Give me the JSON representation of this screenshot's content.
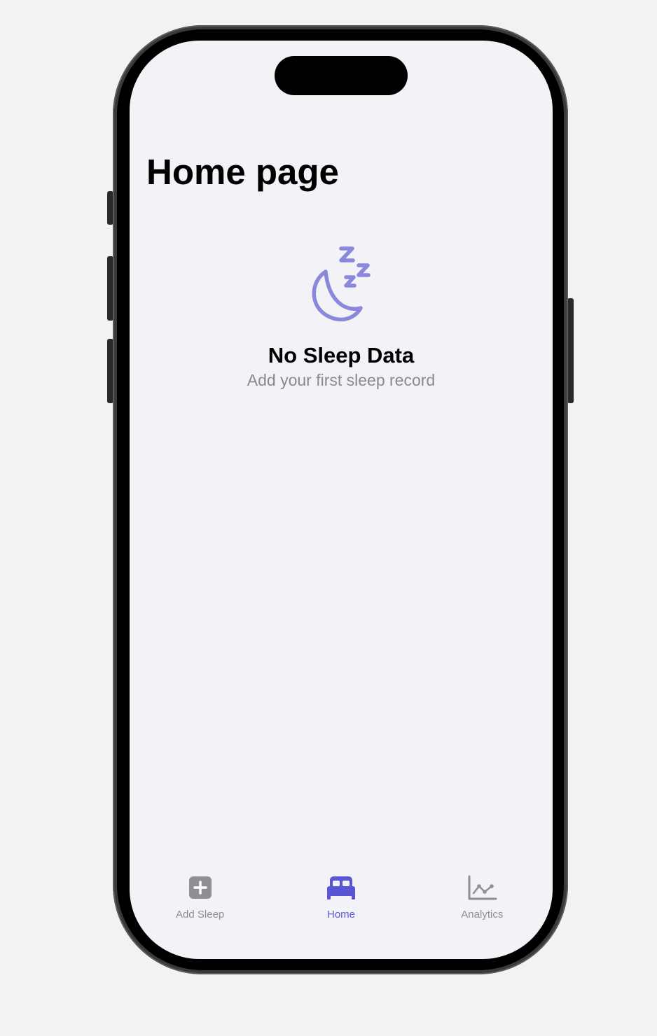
{
  "page": {
    "title": "Home page"
  },
  "empty_state": {
    "icon": "moon-zzz-icon",
    "title": "No Sleep Data",
    "subtitle": "Add your first sleep record"
  },
  "tab_bar": {
    "tabs": [
      {
        "label": "Add Sleep",
        "icon": "plus-square-icon",
        "active": false
      },
      {
        "label": "Home",
        "icon": "bed-icon",
        "active": true
      },
      {
        "label": "Analytics",
        "icon": "line-chart-icon",
        "active": false
      }
    ]
  },
  "colors": {
    "accent": "#5856d6",
    "icon_muted": "#8b87dc",
    "inactive": "#8e8e93",
    "background": "#f2f2f7"
  }
}
